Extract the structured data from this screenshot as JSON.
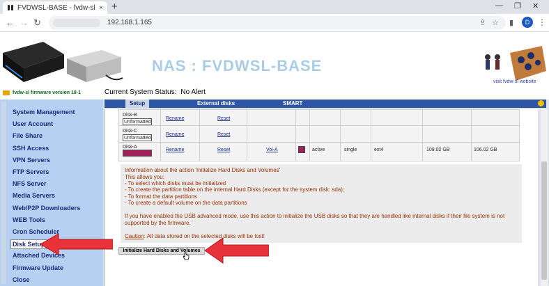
{
  "browser": {
    "tab_title": "FVDWSL-BASE - fvdw-sl Network",
    "tab_close": "×",
    "new_tab": "+",
    "win_minimize": "—",
    "win_restore": "❐",
    "win_close": "✕",
    "url": "192.168.1.165",
    "back": "←",
    "forward": "→",
    "reload": "↻",
    "share": "⇪",
    "star": "☆",
    "side_panel": "▮",
    "profile_initial": "D",
    "menu": "⋮"
  },
  "header": {
    "title": "NAS : FVDWSL-BASE",
    "visit_link": "visit fvdw-sl website",
    "firmware": "fvdw-sl firmware version 18-1",
    "status_label": "Current System Status:",
    "status_value": "No Alert"
  },
  "sidebar": {
    "items": [
      {
        "label": "System Management"
      },
      {
        "label": "User Account"
      },
      {
        "label": "File Share"
      },
      {
        "label": "SSH Access"
      },
      {
        "label": "VPN Servers"
      },
      {
        "label": "FTP Servers"
      },
      {
        "label": "NFS Server"
      },
      {
        "label": "Media Servers"
      },
      {
        "label": "Web/P2P Downloaders"
      },
      {
        "label": "WEB Tools"
      },
      {
        "label": "Cron Scheduler"
      },
      {
        "label": "Disk Setup"
      },
      {
        "label": "Attached Devices"
      },
      {
        "label": "Firmware Update"
      },
      {
        "label": "Close"
      }
    ]
  },
  "tabs": {
    "setup": "Setup",
    "external": "External disks",
    "smart": "SMART"
  },
  "disks": [
    {
      "name": "Disk-B",
      "status": "Unformatted",
      "rename": "Rename",
      "reset": "Reset"
    },
    {
      "name": "Disk-C",
      "status": "Unformatted",
      "rename": "Rename",
      "reset": "Reset"
    },
    {
      "name": "Disk-A",
      "rename": "Rename",
      "reset": "Reset",
      "volume": "Vol-A",
      "state": "active",
      "mode": "single",
      "fs": "ext4",
      "total": "109.02 GB",
      "free": "106.02 GB",
      "color": "#a0215a"
    }
  ],
  "info": {
    "l1": "Information about the action 'Initialize Hard Disks and Volumes'",
    "l2": "This allows you:",
    "l3": "- To select which disks must be initialized",
    "l4": "- To create the partition table on the internal Hard Disks (except for the system disk: sda);",
    "l5": "- To format the data partitions",
    "l6": "- To create a default volume on the data partitions",
    "l7": "If you have enabled the USB advanced mode, use this action to initialize the USB disks so that they are handled like internal disks if their file system is not",
    "l8": "supported by the firmware.",
    "caution_label": "Caution",
    "caution_text": ": All data stored on the selected disks will be lost!"
  },
  "button": {
    "init": "Initialize Hard Disks and Volumes"
  }
}
